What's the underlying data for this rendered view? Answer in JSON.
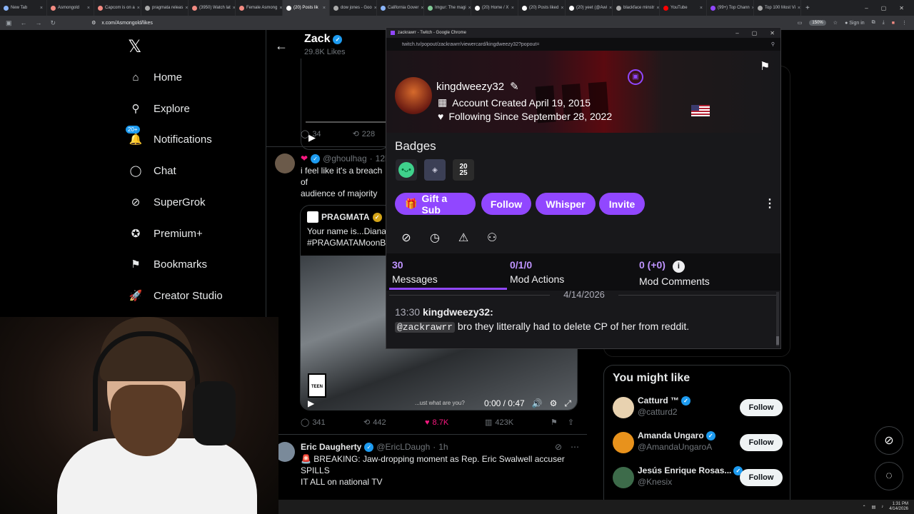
{
  "browser": {
    "tabs": [
      {
        "label": "New Tab",
        "color": "#8ab4f8"
      },
      {
        "label": "Asmongold",
        "color": "#f28b82"
      },
      {
        "label": "Capcom is on a",
        "color": "#f28b82"
      },
      {
        "label": "pragmata releas",
        "color": "#aaaaaa"
      },
      {
        "label": "(3950) Watch lat",
        "color": "#f28b82"
      },
      {
        "label": "Female Asmong",
        "color": "#f28b82"
      },
      {
        "label": "(20) Posts lik",
        "color": "#ffffff",
        "active": true
      },
      {
        "label": "dow jones - Goo",
        "color": "#aaaaaa"
      },
      {
        "label": "California Gover",
        "color": "#8ab4f8"
      },
      {
        "label": "Imgur: The magi",
        "color": "#81c995"
      },
      {
        "label": "(20) Home / X",
        "color": "#ffffff"
      },
      {
        "label": "(20) Posts liked",
        "color": "#ffffff"
      },
      {
        "label": "(20) yeet (@Awi",
        "color": "#ffffff"
      },
      {
        "label": "blackface minstr",
        "color": "#aaaaaa"
      },
      {
        "label": "YouTube",
        "color": "#ff0000"
      },
      {
        "label": "(99+) Top Chann",
        "color": "#9147ff"
      },
      {
        "label": "Top 100 Most Vi",
        "color": "#aaaaaa"
      }
    ],
    "url": "x.com/Asmongold/likes",
    "zoom": "150%",
    "profile_label": "Sign in"
  },
  "xnav": {
    "logo": "𝕏",
    "items": [
      {
        "label": "Home",
        "icon": "home-icon",
        "glyph": "⌂"
      },
      {
        "label": "Explore",
        "icon": "search-icon",
        "glyph": "⚲"
      },
      {
        "label": "Notifications",
        "icon": "bell-icon",
        "glyph": "🔔",
        "badge": "20+"
      },
      {
        "label": "Chat",
        "icon": "chat-icon",
        "glyph": "◯"
      },
      {
        "label": "SuperGrok",
        "icon": "grok-icon",
        "glyph": "⊘"
      },
      {
        "label": "Premium+",
        "icon": "premium-icon",
        "glyph": "✪"
      },
      {
        "label": "Bookmarks",
        "icon": "bookmark-icon",
        "glyph": "⚑"
      },
      {
        "label": "Creator Studio",
        "icon": "rocket-icon",
        "glyph": "🚀"
      }
    ]
  },
  "profile": {
    "name": "Zack",
    "likes": "29.8K Likes"
  },
  "tweets": [
    {
      "stats": {
        "replies": "34",
        "retweets": "228"
      }
    },
    {
      "handle": "@ghoulhag",
      "time": "12h",
      "text": "i feel like it's a breach of\naudience of majority ma\nbanned on reddit)",
      "quote": {
        "author": "PRAGMATA",
        "text": "Your name is...Diana\n#PRAGMATAMoonByt"
      },
      "video": {
        "time": "0:00 / 0:47",
        "rating": "TEEN",
        "caption": "...ust what are you?"
      },
      "stats": {
        "replies": "341",
        "retweets": "442",
        "likes": "8.7K",
        "views": "423K"
      }
    },
    {
      "author": "Eric Daugherty",
      "handle": "@EricLDaugh",
      "time": "1h",
      "text": "🚨 BREAKING: Jaw-dropping moment as Rep. Eric Swalwell accuser SPILLS\nIT ALL on national TV\n\n\"He r*ped me and he choked me.\""
    }
  ],
  "twitch": {
    "window_title": "zackrawrr - Twitch - Google Chrome",
    "url": "twitch.tv/popout/zackrawrr/viewercard/kingdweezy32?popout=",
    "username": "kingdweezy32",
    "account_created": "Account Created April 19, 2015",
    "following_since": "Following Since September 28, 2022",
    "badges_title": "Badges",
    "badge3_label": "20\n25",
    "buttons": {
      "gift": "Gift a Sub",
      "follow": "Follow",
      "whisper": "Whisper",
      "invite": "Invite"
    },
    "stats": {
      "messages_num": "30",
      "messages_lbl": "Messages",
      "modactions_num": "0/1/0",
      "modactions_lbl": "Mod Actions",
      "modcomments_num": "0 (+0)",
      "modcomments_lbl": "Mod Comments"
    },
    "date": "4/14/2026",
    "chat": {
      "time": "13:30",
      "user": "kingdweezy32:",
      "mention": "@zackrawrr",
      "message": " bro they litterally had to delete CP of her from reddit."
    }
  },
  "you_might_like": {
    "title": "You might like",
    "accounts": [
      {
        "name": "Catturd ™",
        "handle": "@catturd2",
        "button": "Follow",
        "avatar_color": "#e8d2b0"
      },
      {
        "name": "Amanda Ungaro",
        "handle": "@AmandaUngaroA",
        "button": "Follow",
        "avatar_color": "#e8921c"
      },
      {
        "name": "Jesús Enrique Rosas...",
        "handle": "@Knesix",
        "button": "Follow",
        "avatar_color": "#3d6b4a"
      }
    ]
  },
  "taskbar": {
    "time": "1:31 PM",
    "date": "4/14/2026"
  }
}
